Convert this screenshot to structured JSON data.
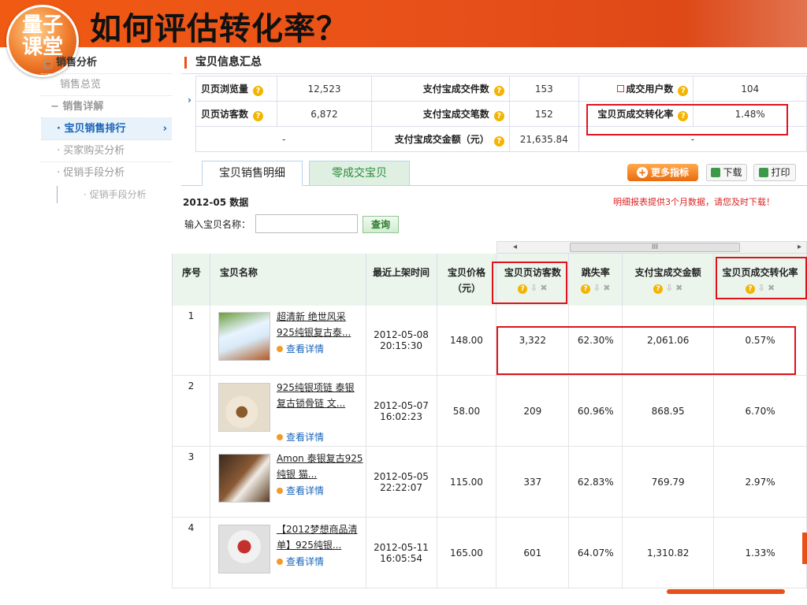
{
  "header": {
    "title": "如何评估转化率？",
    "logo_line1": "量子",
    "logo_line2": "课堂"
  },
  "sidebar": {
    "section": "销售分析",
    "overview": "销售总览",
    "detail_group": "销售详解",
    "active_item": "宝贝销售排行",
    "item_buyer": "买家购买分析",
    "item_promo": "促销手段分析",
    "item_promo_sub": "促销手段分析"
  },
  "summary": {
    "title": "宝贝信息汇总",
    "rows": [
      [
        {
          "label": "贝页浏览量",
          "value": "12,523"
        },
        {
          "label": "支付宝成交件数",
          "value": "153"
        },
        {
          "label": "成交用户数",
          "value": "104"
        }
      ],
      [
        {
          "label": "贝页访客数",
          "value": "6,872"
        },
        {
          "label": "支付宝成交笔数",
          "value": "152"
        },
        {
          "label": "宝贝页成交转化率",
          "value": "1.48%"
        }
      ],
      [
        {
          "label": "",
          "value": "-"
        },
        {
          "label": "支付宝成交金额（元）",
          "value": "21,635.84"
        },
        {
          "label": "",
          "value": "-"
        }
      ]
    ]
  },
  "tabs": {
    "active": "宝贝销售明细",
    "inactive": "零成交宝贝",
    "more": "更多指标",
    "download": "下载",
    "print": "打印"
  },
  "filter": {
    "date_label": "2012-05 数据",
    "notice": "明细报表提供3个月数据，请您及时下载！",
    "search_label": "输入宝贝名称：",
    "search_value": "",
    "search_button": "查询"
  },
  "table": {
    "headers": {
      "idx": "序号",
      "name": "宝贝名称",
      "listed": "最近上架时间",
      "price": "宝贝价格（元）",
      "visitors": "宝贝页访客数",
      "bounce": "跳失率",
      "amount": "支付宝成交金额",
      "conversion": "宝贝页成交转化率"
    },
    "detail_link": "查看详情",
    "rows": [
      {
        "idx": "1",
        "name": "超清新 绝世风采925纯银复古泰...",
        "date": "2012-05-08",
        "time": "20:15:30",
        "price": "148.00",
        "visitors": "3,322",
        "bounce": "62.30%",
        "amount": "2,061.06",
        "conversion": "0.57%"
      },
      {
        "idx": "2",
        "name": "925纯银项链 泰银复古锁骨链 文...",
        "date": "2012-05-07",
        "time": "16:02:23",
        "price": "58.00",
        "visitors": "209",
        "bounce": "60.96%",
        "amount": "868.95",
        "conversion": "6.70%"
      },
      {
        "idx": "3",
        "name": "Amon 泰银复古925纯银 猫...",
        "date": "2012-05-05",
        "time": "22:22:07",
        "price": "115.00",
        "visitors": "337",
        "bounce": "62.83%",
        "amount": "769.79",
        "conversion": "2.97%"
      },
      {
        "idx": "4",
        "name": "【2012梦想商品清单】925纯银...",
        "date": "2012-05-11",
        "time": "16:05:54",
        "price": "165.00",
        "visitors": "601",
        "bounce": "64.07%",
        "amount": "1,310.82",
        "conversion": "1.33%"
      }
    ]
  },
  "colors": {
    "header": "#e8501a",
    "highlight": "#e0121c",
    "table_header": "#ebf5ec",
    "link": "#1a64b8"
  }
}
